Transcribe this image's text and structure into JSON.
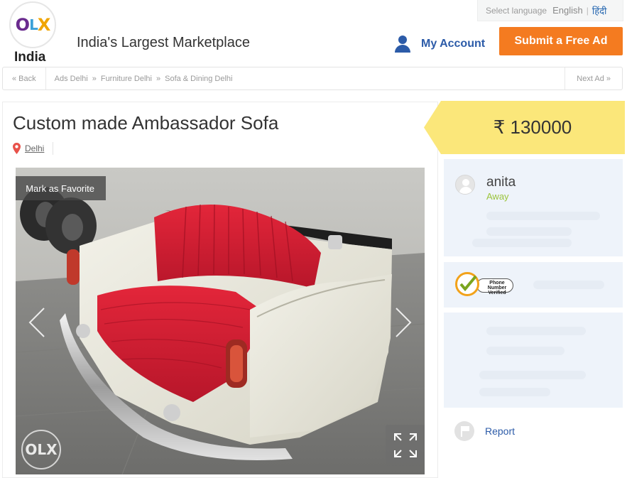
{
  "header": {
    "logo": {
      "text_o": "O",
      "text_l": "L",
      "text_x": "X",
      "country": "India"
    },
    "tagline": "India's Largest Marketplace",
    "language": {
      "label": "Select language",
      "english": "English",
      "separator": "|",
      "hindi": "हिंदी"
    },
    "my_account_label": "My Account",
    "submit_ad_label": "Submit a Free Ad",
    "accent_color": "#f47b20",
    "link_color": "#2c5ba8"
  },
  "breadcrumb": {
    "back_label": "« Back",
    "items": [
      "Ads Delhi",
      "Furniture Delhi",
      "Sofa & Dining Delhi"
    ],
    "separator": "»",
    "next_label": "Next Ad »"
  },
  "ad": {
    "title": "Custom made Ambassador Sofa",
    "location": "Delhi",
    "favorite_label": "Mark as Favorite",
    "watermark": "OLX",
    "price": "₹ 130000",
    "price_bg_color": "#fbe77a"
  },
  "seller": {
    "name": "anita",
    "status": "Away",
    "status_color": "#9bc43b",
    "badge_text": "Phone Number Verified"
  },
  "report_label": "Report",
  "icons": [
    "user-icon",
    "pin-icon",
    "chevron-left-icon",
    "chevron-right-icon",
    "expand-icon",
    "check-icon",
    "flag-icon",
    "avatar-icon"
  ]
}
